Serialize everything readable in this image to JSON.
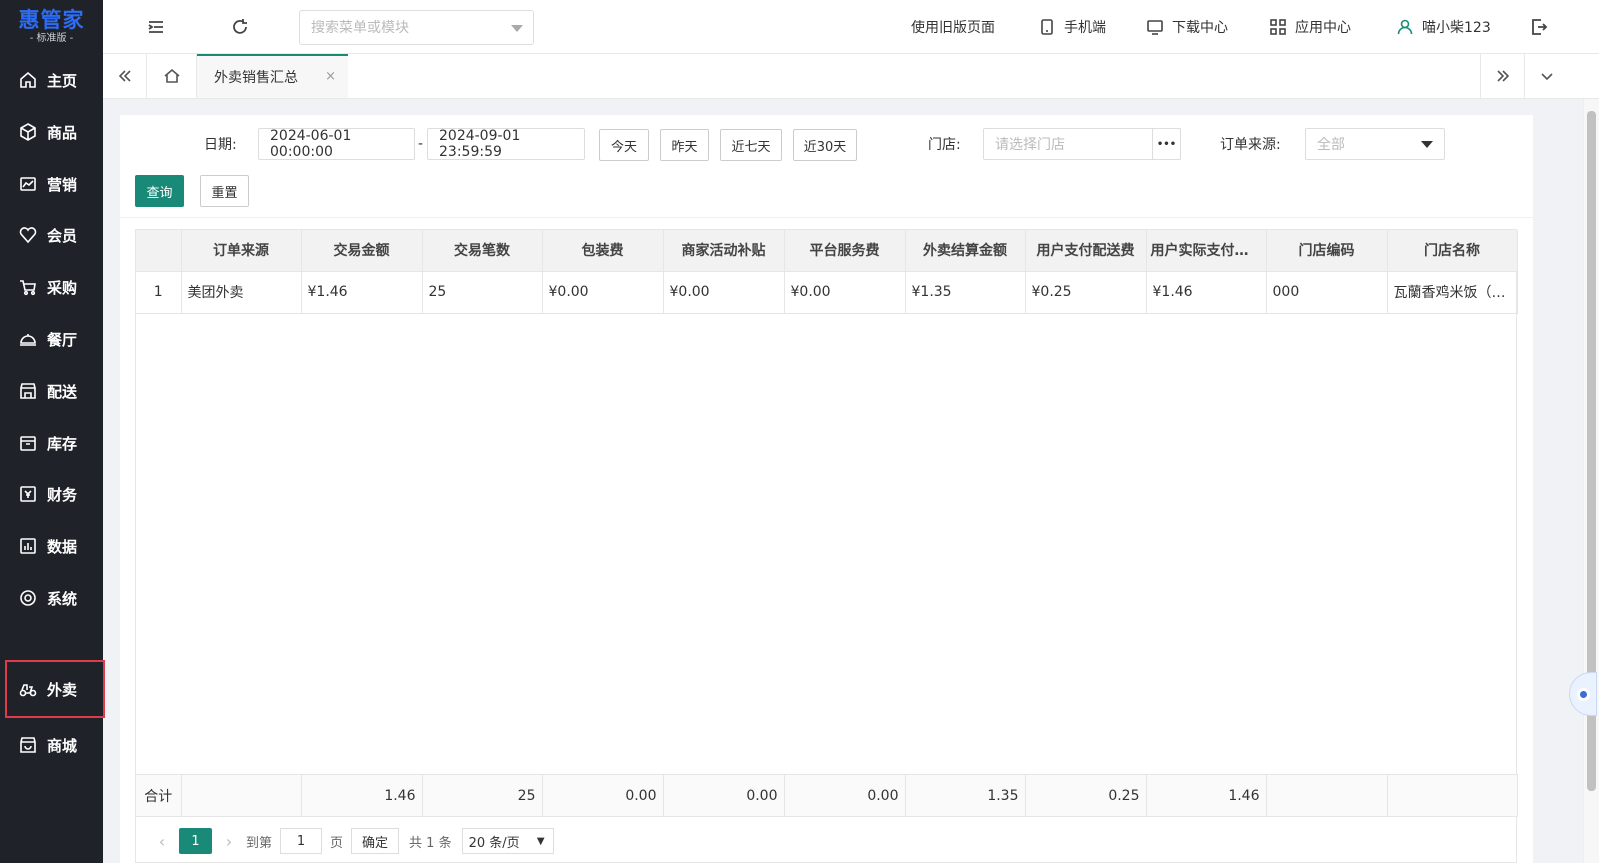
{
  "sidebar": {
    "brand": "惠管家",
    "edition": "- 标准版 -",
    "items": [
      {
        "label": "主页",
        "icon": "home-icon"
      },
      {
        "label": "商品",
        "icon": "box-icon"
      },
      {
        "label": "营销",
        "icon": "chart-icon"
      },
      {
        "label": "会员",
        "icon": "heart-icon"
      },
      {
        "label": "采购",
        "icon": "cart-icon"
      },
      {
        "label": "餐厅",
        "icon": "cloche-icon"
      },
      {
        "label": "配送",
        "icon": "store-icon"
      },
      {
        "label": "库存",
        "icon": "warehouse-icon"
      },
      {
        "label": "财务",
        "icon": "finance-icon"
      },
      {
        "label": "数据",
        "icon": "data-icon"
      },
      {
        "label": "系统",
        "icon": "settings-icon"
      },
      {
        "label": "外卖",
        "icon": "delivery-icon"
      },
      {
        "label": "商城",
        "icon": "mall-icon"
      }
    ]
  },
  "header": {
    "search_placeholder": "搜索菜单或模块",
    "old_version": "使用旧版页面",
    "mobile": "手机端",
    "download": "下载中心",
    "apps": "应用中心",
    "user": "喵小柴123"
  },
  "tabs": {
    "active": "外卖销售汇总",
    "close": "×"
  },
  "filters": {
    "date_label": "日期:",
    "date_start": "2024-06-01 00:00:00",
    "date_sep": "-",
    "date_end": "2024-09-01 23:59:59",
    "today": "今天",
    "yesterday": "昨天",
    "last7": "近七天",
    "last30": "近30天",
    "store_label": "门店:",
    "store_placeholder": "请选择门店",
    "store_more": "•••",
    "source_label": "订单来源:",
    "source_value": "全部",
    "query": "查询",
    "reset": "重置"
  },
  "table": {
    "columns": [
      "",
      "订单来源",
      "交易金额",
      "交易笔数",
      "包装费",
      "商家活动补贴",
      "平台服务费",
      "外卖结算金额",
      "用户支付配送费",
      "用户实际支付金额",
      "门店编码",
      "门店名称"
    ],
    "rows": [
      [
        "1",
        "美团外卖",
        "¥1.46",
        "25",
        "¥0.00",
        "¥0.00",
        "¥0.00",
        "¥1.35",
        "¥0.25",
        "¥1.46",
        "000",
        "瓦蘭香鸡米饭（总店）"
      ]
    ],
    "totals": [
      "合计",
      "",
      "1.46",
      "25",
      "0.00",
      "0.00",
      "0.00",
      "1.35",
      "0.25",
      "1.46",
      "",
      ""
    ]
  },
  "pager": {
    "current": "1",
    "goto_label": "到第",
    "goto_value": "1",
    "page_unit": "页",
    "confirm": "确定",
    "total": "共 1 条",
    "page_size": "20 条/页"
  },
  "colors": {
    "primary": "#1a8a78",
    "sidebar_bg": "#1f2329",
    "brand": "#2d6cf6",
    "highlight_border": "#e0394a"
  }
}
